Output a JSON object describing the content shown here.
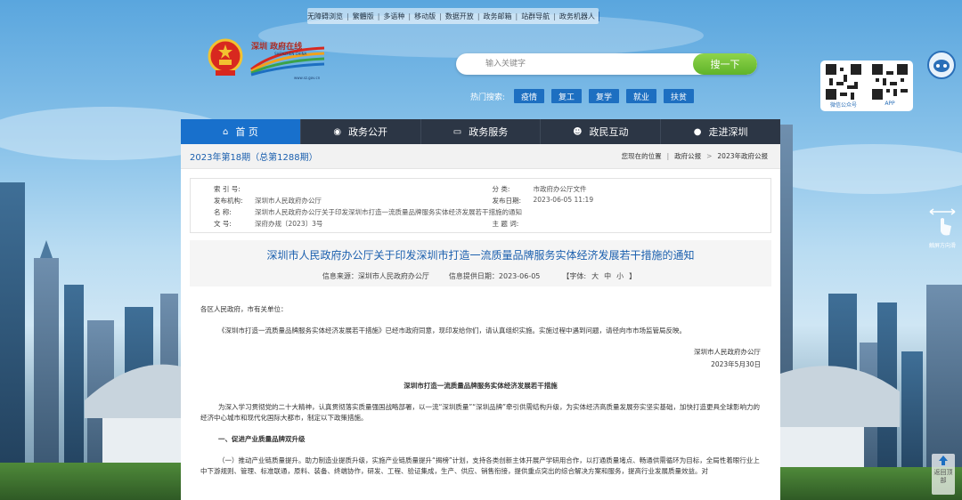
{
  "top_links": [
    "无障碍浏览",
    "繁體版",
    "多语种",
    "移动版",
    "数据开放",
    "政务邮箱",
    "站群导航",
    "政务机器人"
  ],
  "logo": {
    "cn": "深圳 政府在线",
    "en": "SHENZHEN CHINA",
    "url": "www.sz.gov.cn"
  },
  "search": {
    "placeholder": "输入关键字",
    "button": "搜一下"
  },
  "hot": {
    "label": "热门搜索:",
    "tags": [
      "疫情",
      "复工",
      "复学",
      "就业",
      "扶贫"
    ]
  },
  "qr": {
    "wechat": "微信公众号",
    "app": "APP"
  },
  "swipe_label": "触屏方向滑",
  "back_top": "返回顶部",
  "nav": [
    {
      "label": "首  页",
      "icon": "home-icon"
    },
    {
      "label": "政务公开",
      "icon": "eye-icon"
    },
    {
      "label": "政务服务",
      "icon": "monitor-icon"
    },
    {
      "label": "政民互动",
      "icon": "people-icon"
    },
    {
      "label": "走进深圳",
      "icon": "info-icon"
    }
  ],
  "issue": {
    "title": "2023年第18期（总第1288期）"
  },
  "breadcrumb": {
    "prefix": "您现在的位置",
    "items": [
      "政府公报",
      "2023年政府公报"
    ]
  },
  "meta": {
    "index_label": "索 引 号:",
    "index_val": "",
    "category_label": "分    类:",
    "category_val": "市政府办公厅文件",
    "publisher_label": "发布机构:",
    "publisher_val": "深圳市人民政府办公厅",
    "date_label": "发布日期:",
    "date_val": "2023-06-05  11:19",
    "name_label": "名    称:",
    "name_val": "深圳市人民政府办公厅关于印发深圳市打造一流质量品牌服务实体经济发展若干措施的通知",
    "docno_label": "文    号:",
    "docno_val": "深府办规〔2023〕3号",
    "keywords_label": "主 题 词:",
    "keywords_val": ""
  },
  "doc": {
    "title": "深圳市人民政府办公厅关于印发深圳市打造一流质量品牌服务实体经济发展若干措施的通知",
    "source": "信息来源：深圳市人民政府办公厅",
    "provided": "信息提供日期：2023-06-05",
    "font_label": "【字体:",
    "font_sizes": [
      "大",
      "中",
      "小"
    ],
    "font_end": "】"
  },
  "body": {
    "greeting": "各区人民政府，市有关单位：",
    "p1": "《深圳市打造一流质量品牌服务实体经济发展若干措施》已经市政府同意，现印发给你们，请认真组织实施。实施过程中遇到问题，请径向市市场监管局反映。",
    "signer": "深圳市人民政府办公厅",
    "sign_date": "2023年5月30日",
    "heading": "深圳市打造一流质量品牌服务实体经济发展若干措施",
    "p2": "为深入学习贯彻党的二十大精神，认真贯彻落实质量强国战略部署，以一流“深圳质量”“深圳品牌”牵引供需结构升级，为实体经济高质量发展夯实坚实基础，加快打造更具全球影响力的经济中心城市和现代化国际大都市，制定以下政策措施。",
    "section1": "一、促进产业质量品牌双升级",
    "p3": "（一）推动产业链质量提升。助力制造业提质升级，实施产业链质量提升“揭榜”计划，支持各类创新主体开展产学研用合作，以打通质量堵点、畅通供需循环为目标，全局性着眼行业上中下游规则、管理、标准联通，原料、装备、终端协作，研发、工程、验证集成，生产、供应、销售衔接，提供重点突出的综合解决方案和服务，提高行业发展质量效益。对"
  }
}
